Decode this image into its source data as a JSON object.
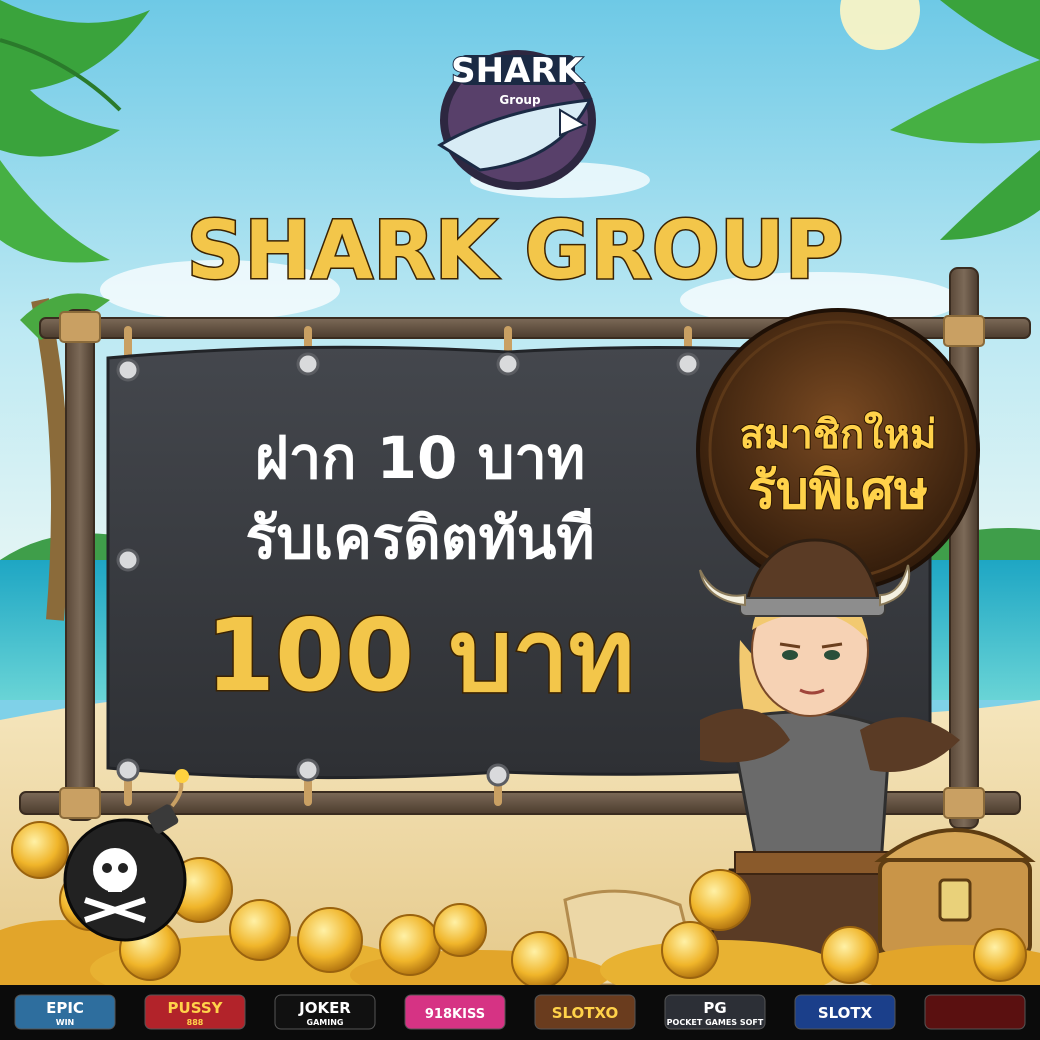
{
  "logo": {
    "name": "SHARK",
    "subtitle": "Group"
  },
  "headline": "SHARK GROUP",
  "banner": {
    "line1": "ฝาก 10 บาท",
    "line2": "รับเครดิตทันที",
    "amount": "100 บาท"
  },
  "badge": {
    "line1": "สมาชิกใหม่",
    "line2": "รับพิเศษ"
  },
  "providers": [
    {
      "name": "EPIC",
      "sub": "WIN"
    },
    {
      "name": "PUSSY",
      "sub": "888"
    },
    {
      "name": "JOKER",
      "sub": "GAMING"
    },
    {
      "name": "918KISS",
      "sub": ""
    },
    {
      "name": "SLOTXO",
      "sub": ""
    },
    {
      "name": "PG",
      "sub": "POCKET GAMES SOFT"
    },
    {
      "name": "SLOTX",
      "sub": ""
    },
    {
      "name": "",
      "sub": ""
    }
  ],
  "colors": {
    "sky": "#7fd1e8",
    "sea": "#2ab4c9",
    "sand": "#f1dfb0",
    "gold": "#f3c64a",
    "banner": "#3b3d42",
    "wood": "#6e5a48",
    "rope": "#caa064",
    "footer": "#0b0b0b"
  }
}
